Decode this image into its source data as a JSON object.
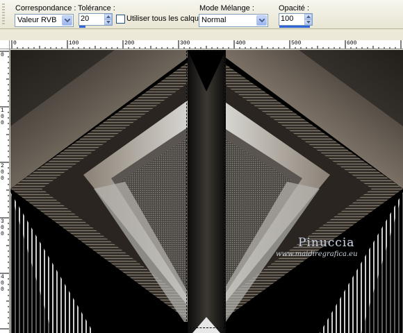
{
  "toolbar": {
    "correspondance": {
      "label": "Correspondance :",
      "value": "Valeur RVB"
    },
    "tolerance": {
      "label": "Tolérance :",
      "value": "20",
      "fill_fraction": 0.2
    },
    "all_layers": {
      "label": "Utiliser tous les calques",
      "checked": false
    },
    "blend_mode": {
      "label": "Mode Mélange :",
      "value": "Normal"
    },
    "opacity": {
      "label": "Opacité :",
      "value": "100"
    }
  },
  "ruler": {
    "horizontal_labels": [
      "0",
      "100",
      "200",
      "300",
      "400",
      "500",
      "600"
    ],
    "vertical_labels": [
      "0",
      "100",
      "200",
      "300",
      "400"
    ]
  },
  "canvas": {
    "watermark_signature": "Pinuccia",
    "watermark_url": "www.maidiregrafica.eu"
  },
  "colors": {
    "toolbar_bg": "#ece9d8",
    "input_border": "#7f9db9",
    "tolerance_bar": "#2f63d6"
  }
}
